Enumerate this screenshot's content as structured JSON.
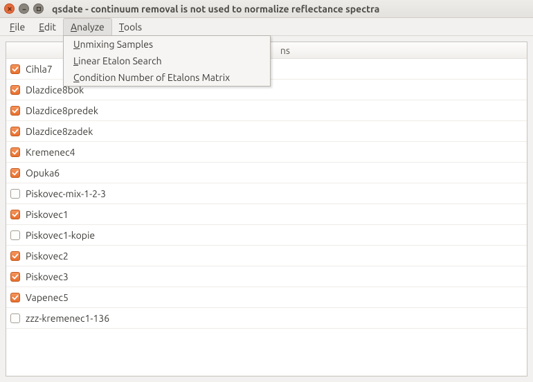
{
  "window": {
    "title": "qsdate - continuum removal is not used to normalize reflectance spectra"
  },
  "menubar": {
    "items": [
      {
        "label": "File",
        "accel": "F"
      },
      {
        "label": "Edit",
        "accel": "E"
      },
      {
        "label": "Analyze",
        "accel": "A",
        "active": true
      },
      {
        "label": "Tools",
        "accel": "T"
      }
    ]
  },
  "analyze_menu": {
    "items": [
      {
        "label": "Unmixing Samples",
        "accel": "U"
      },
      {
        "label": "Linear Etalon Search",
        "accel": "L"
      },
      {
        "label": "Condition Number of Etalons Matrix",
        "accel": "C"
      }
    ]
  },
  "list": {
    "header_visible_fragment": "ns",
    "rows": [
      {
        "name": "Cihla7",
        "checked": true
      },
      {
        "name": "Dlazdice8bok",
        "checked": true
      },
      {
        "name": "Dlazdice8predek",
        "checked": true
      },
      {
        "name": "Dlazdice8zadek",
        "checked": true
      },
      {
        "name": "Kremenec4",
        "checked": true
      },
      {
        "name": "Opuka6",
        "checked": true
      },
      {
        "name": "Piskovec-mix-1-2-3",
        "checked": false
      },
      {
        "name": "Piskovec1",
        "checked": true
      },
      {
        "name": "Piskovec1-kopie",
        "checked": false
      },
      {
        "name": "Piskovec2",
        "checked": true
      },
      {
        "name": "Piskovec3",
        "checked": true
      },
      {
        "name": "Vapenec5",
        "checked": true
      },
      {
        "name": "zzz-kremenec1-136",
        "checked": false
      }
    ]
  }
}
